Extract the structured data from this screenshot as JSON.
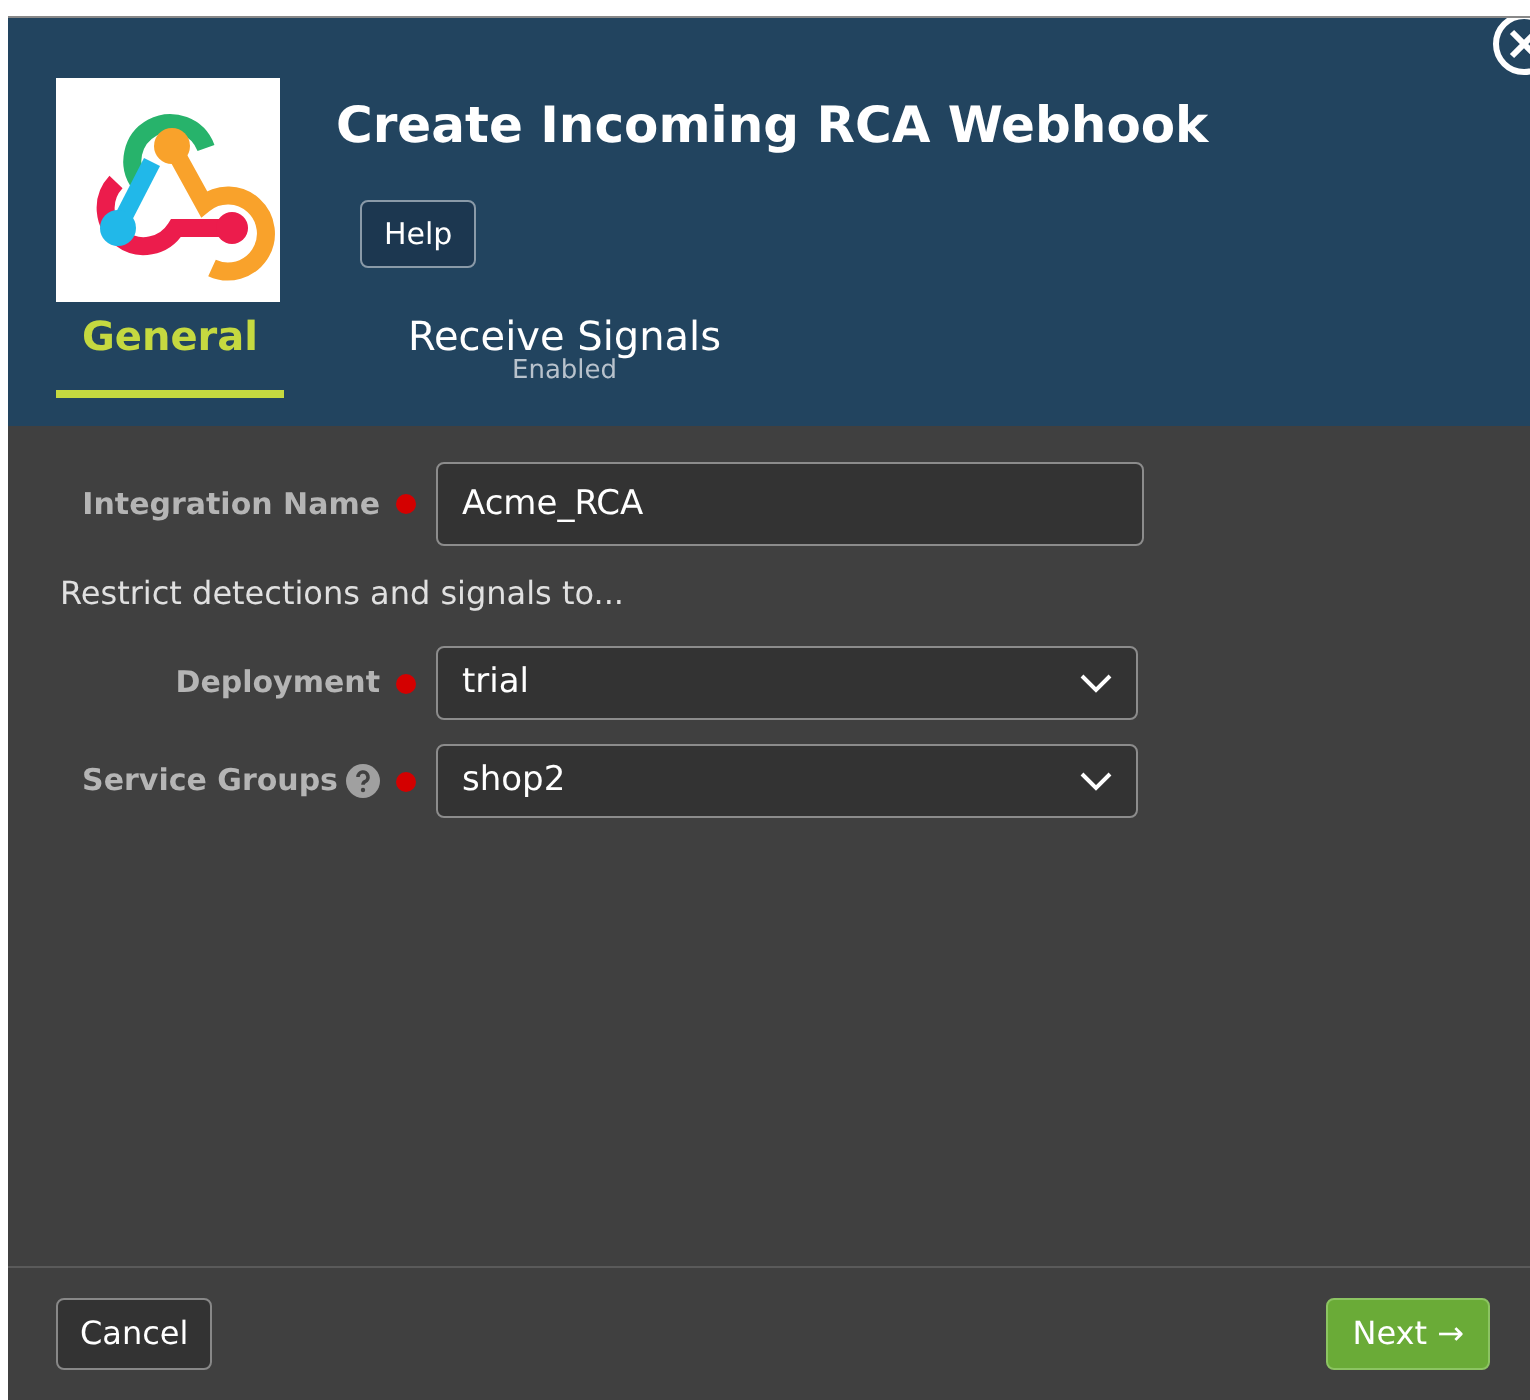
{
  "dialog": {
    "title": "Create Incoming RCA Webhook",
    "help_button": "Help"
  },
  "tabs": [
    {
      "label": "General",
      "selected": true
    },
    {
      "label": "Receive Signals",
      "subtitle": "Enabled",
      "selected": false
    }
  ],
  "fields": [
    {
      "kind": "text",
      "label": "Integration Name",
      "required": true,
      "help": false,
      "value": "Acme_RCA"
    },
    {
      "kind": "note",
      "text": "Restrict detections and signals to..."
    },
    {
      "kind": "select",
      "label": "Deployment",
      "required": true,
      "help": false,
      "value": "trial"
    },
    {
      "kind": "select",
      "label": "Service Groups",
      "required": true,
      "help": true,
      "value": "shop2"
    }
  ],
  "footer": {
    "cancel": "Cancel",
    "next": "Next →"
  }
}
